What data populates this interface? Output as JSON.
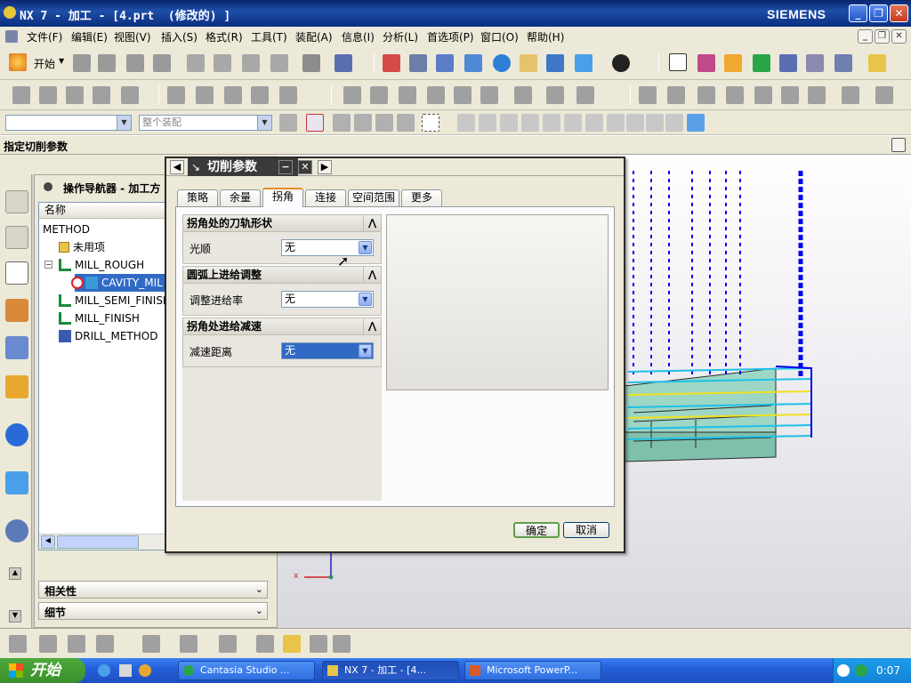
{
  "window": {
    "title": "NX 7 - 加工 - [4.prt  (修改的) ]",
    "brand": "SIEMENS",
    "minimize": "_",
    "restore": "❐",
    "close": "✕"
  },
  "menu": [
    "文件(F)",
    "编辑(E)",
    "视图(V)",
    "插入(S)",
    "格式(R)",
    "工具(T)",
    "装配(A)",
    "信息(I)",
    "分析(L)",
    "首选项(P)",
    "窗口(O)",
    "帮助(H)"
  ],
  "toolbar": {
    "start_label": "开始",
    "assembly_combo": "整个装配"
  },
  "cue_line": "指定切削参数",
  "navigator": {
    "title": "操作导航器 - 加工方",
    "column": "名称",
    "items": [
      {
        "label": "METHOD"
      },
      {
        "label": "未用项"
      },
      {
        "label": "MILL_ROUGH"
      },
      {
        "label": "CAVITY_MIL"
      },
      {
        "label": "MILL_SEMI_FINISH"
      },
      {
        "label": "MILL_FINISH"
      },
      {
        "label": "DRILL_METHOD"
      }
    ],
    "panels": [
      "相关性",
      "细节"
    ]
  },
  "dialog": {
    "title": "切削参数",
    "tabs": [
      "策略",
      "余量",
      "拐角",
      "连接",
      "空间范围",
      "更多"
    ],
    "active_tab": "拐角",
    "sections": [
      {
        "title": "拐角处的刀轨形状",
        "label": "光顺",
        "value": "无"
      },
      {
        "title": "圆弧上进给调整",
        "label": "调整进给率",
        "value": "无"
      },
      {
        "title": "拐角处进给减速",
        "label": "减速距离",
        "value": "无"
      }
    ],
    "ok": "确定",
    "cancel": "取消"
  },
  "taskbar": {
    "start": "开始",
    "tasks": [
      "Cantasia Studio ...",
      "NX 7 - 加工 - [4...",
      "Microsoft PowerP..."
    ],
    "clock": "0:07"
  },
  "colors": {
    "title_bar": "#0a246a",
    "taskbar": "#2560d8",
    "toolpath": "#0000ee"
  }
}
